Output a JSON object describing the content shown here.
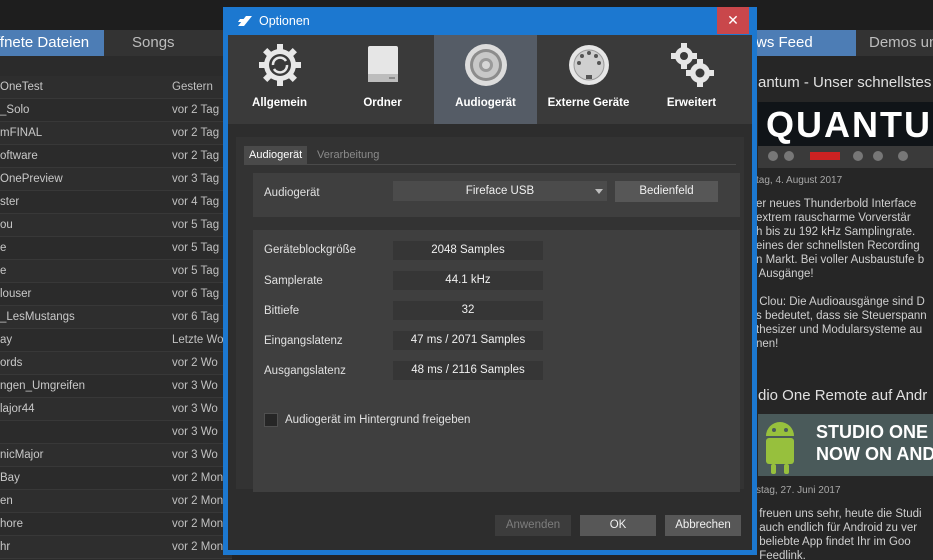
{
  "background": {
    "left_tabs": [
      "ffnete Dateien",
      "Songs"
    ],
    "files": [
      {
        "name": "OneTest",
        "date": "Gestern"
      },
      {
        "name": "_Solo",
        "date": "vor 2 Tag"
      },
      {
        "name": "mFINAL",
        "date": "vor 2 Tag"
      },
      {
        "name": "oftware",
        "date": "vor 2 Tag"
      },
      {
        "name": "OnePreview",
        "date": "vor 3 Tag"
      },
      {
        "name": "ster",
        "date": "vor 4 Tag"
      },
      {
        "name": "ou",
        "date": "vor 5 Tag"
      },
      {
        "name": "e",
        "date": "vor 5 Tag"
      },
      {
        "name": "e",
        "date": "vor 5 Tag"
      },
      {
        "name": "louser",
        "date": "vor 6 Tag"
      },
      {
        "name": "_LesMustangs",
        "date": "vor 6 Tag"
      },
      {
        "name": "ay",
        "date": "Letzte Wo"
      },
      {
        "name": "ords",
        "date": "vor 2 Wo"
      },
      {
        "name": "ngen_Umgreifen",
        "date": "vor 3 Wo"
      },
      {
        "name": "lajor44",
        "date": "vor 3 Wo"
      },
      {
        "name": "",
        "date": "vor 3 Wo"
      },
      {
        "name": "nicMajor",
        "date": "vor 3 Wo"
      },
      {
        "name": "Bay",
        "date": "vor 2 Mon"
      },
      {
        "name": "en",
        "date": "vor 2 Mon"
      },
      {
        "name": "hore",
        "date": "vor 2 Mon"
      },
      {
        "name": "hr",
        "date": "vor 2 Mon"
      }
    ],
    "right_tabs": [
      "ws Feed",
      "Demos un"
    ],
    "news1_title": "antum - Unser schnellstes",
    "news1_banner": "QUANTUM",
    "news1_date": "tag, 4. August 2017",
    "news1_body": "er neues Thunderbold Interface\nextrem rauscharme Vorverstär\nh bis zu 192 kHz Samplingrate. \neines der schnellsten Recording\nn Markt. Bei voller Ausbaustufe b\n Ausgänge!\n\n Clou: Die Audioausgänge sind D\ns bedeutet, dass sie Steuerspann\nthesizer und Modularsysteme au\nnen!",
    "news2_title": "dio One Remote auf Andr",
    "news2_banner_line1": "STUDIO ONE RE",
    "news2_banner_line2": "NOW ON ANDR",
    "news2_date": "stag, 27. Juni 2017",
    "news2_body": " freuen uns sehr, heute die Studi\n auch endlich für Android zu ver\n beliebte App findet Ihr im Goo\n Feedlink."
  },
  "dialog": {
    "title": "Optionen",
    "close_label": "✕",
    "categories": [
      {
        "label": "Allgemein",
        "icon": "gear-refresh-icon"
      },
      {
        "label": "Ordner",
        "icon": "drive-icon"
      },
      {
        "label": "Audiogerät",
        "icon": "speaker-icon"
      },
      {
        "label": "Externe Geräte",
        "icon": "midi-port-icon"
      },
      {
        "label": "Erweitert",
        "icon": "gears-icon"
      }
    ],
    "active_category": "Audiogerät",
    "subtabs": [
      "Audiogerät",
      "Verarbeitung"
    ],
    "device_label": "Audiogerät",
    "device_value": "Fireface USB",
    "control_panel_button": "Bedienfeld",
    "settings": [
      {
        "label": "Geräteblockgröße",
        "value": "2048 Samples"
      },
      {
        "label": "Samplerate",
        "value": "44.1 kHz"
      },
      {
        "label": "Bittiefe",
        "value": "32"
      },
      {
        "label": "Eingangslatenz",
        "value": "47 ms / 2071 Samples"
      },
      {
        "label": "Ausgangslatenz",
        "value": "48 ms / 2116 Samples"
      }
    ],
    "background_checkbox_label": "Audiogerät im Hintergrund freigeben",
    "background_checkbox_checked": false,
    "buttons": {
      "apply": "Anwenden",
      "ok": "OK",
      "cancel": "Abbrechen"
    },
    "colors": {
      "titlebar": "#1c78d0",
      "close": "#c9474b",
      "active_category": "#555c66"
    }
  }
}
